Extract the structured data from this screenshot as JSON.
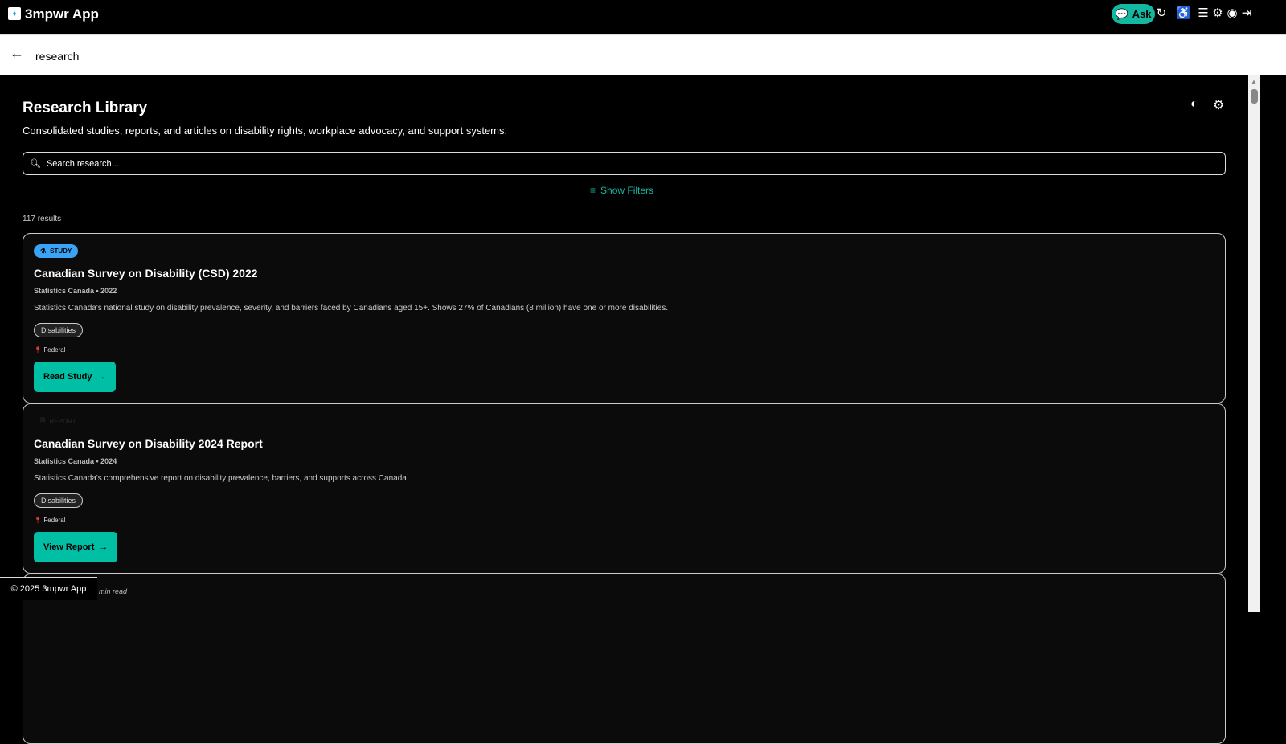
{
  "app": {
    "title": "3mpwr App",
    "ask_label": "Ask"
  },
  "nav": {
    "breadcrumb": "research"
  },
  "page": {
    "title": "Research Library",
    "subtitle": "Consolidated studies, reports, and articles on disability rights, workplace advocacy, and support systems.",
    "search_placeholder": "Search research...",
    "filters_label": "Show Filters",
    "results": "117 results"
  },
  "cards": [
    {
      "type": "STUDY",
      "title": "Canadian Survey on Disability (CSD) 2022",
      "meta": "Statistics Canada • 2022",
      "description": "Statistics Canada's national study on disability prevalence, severity, and barriers faced by Canadians aged 15+. Shows 27% of Canadians (8 million) have one or more disabilities.",
      "tag": "Disabilities",
      "location": "Federal",
      "action": "Read Study"
    },
    {
      "type": "REPORT",
      "title": "Canadian Survey on Disability 2024 Report",
      "meta": "Statistics Canada • 2024",
      "description": "Statistics Canada's comprehensive report on disability prevalence, barriers, and supports across Canada.",
      "tag": "Disabilities",
      "location": "Federal",
      "action": "View Report"
    }
  ],
  "partial_card": {
    "min_read": "min read"
  },
  "footer": {
    "copyright": "© 2025 3mpwr App"
  },
  "colors": {
    "accent": "#00bfa5",
    "study_badge": "#3ba3f5",
    "background": "#000000"
  }
}
